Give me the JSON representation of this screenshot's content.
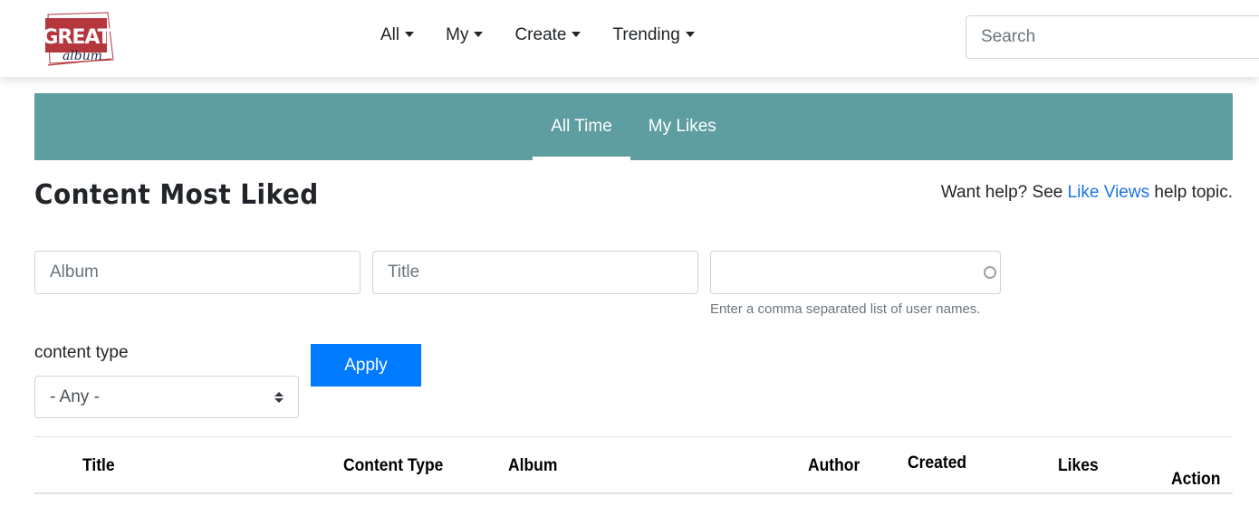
{
  "header": {
    "logo": {
      "line1": "GREAT",
      "line2": "album",
      "brand_color": "#b5373d"
    },
    "nav": [
      {
        "label": "All"
      },
      {
        "label": "My"
      },
      {
        "label": "Create"
      },
      {
        "label": "Trending"
      }
    ],
    "search": {
      "placeholder": "Search",
      "value": ""
    }
  },
  "tabs": [
    {
      "label": "All Time",
      "active": true
    },
    {
      "label": "My Likes",
      "active": false
    }
  ],
  "tab_band_color": "#5f9ea0",
  "page": {
    "title": "Content Most Liked",
    "help": {
      "prefix": "Want help? See ",
      "link": "Like Views",
      "suffix": " help topic."
    }
  },
  "filters": {
    "album": {
      "placeholder": "Album",
      "value": ""
    },
    "title": {
      "placeholder": "Title",
      "value": ""
    },
    "users": {
      "placeholder": "",
      "value": "",
      "help": "Enter a comma separated list of user names."
    },
    "content_type": {
      "label": "content type",
      "selected": "- Any -"
    },
    "apply_label": "Apply",
    "apply_color": "#007bff"
  },
  "table": {
    "columns": [
      "Title",
      "Content Type",
      "Album",
      "Author",
      "Created",
      "Likes",
      "Action"
    ]
  }
}
